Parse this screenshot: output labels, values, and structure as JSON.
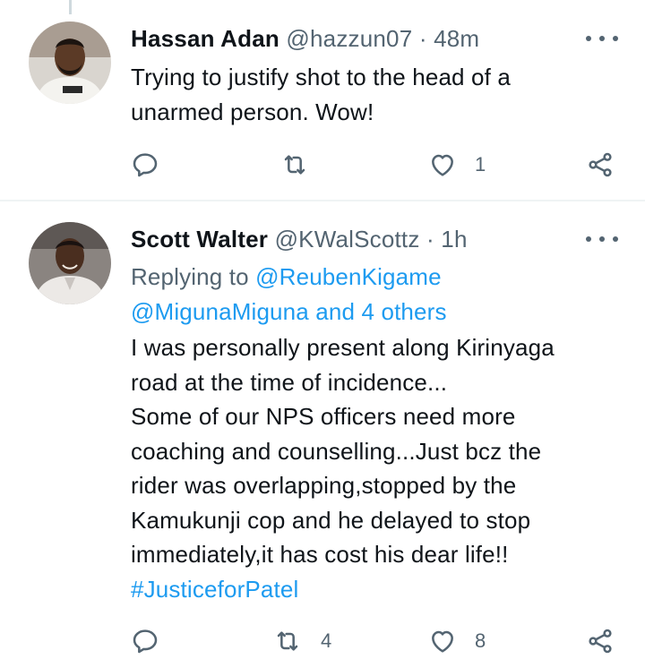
{
  "tweets": [
    {
      "name": "Hassan Adan",
      "handle": "@hazzun07",
      "sep": "·",
      "time": "48m",
      "lines": [
        "Trying to justify shot to the head of a",
        "unarmed person. Wow!"
      ],
      "actions": {
        "reply": "",
        "retweet": "",
        "like": "1"
      }
    },
    {
      "name": "Scott Walter",
      "handle": "@KWalScottz",
      "sep": "·",
      "time": "1h",
      "replying_prefix": "Replying to ",
      "replying_user": "@ReubenKigame",
      "replying_line2": "@MigunaMiguna and 4 others",
      "lines": [
        "I was personally present along Kirinyaga",
        "road at the time of incidence...",
        "Some of our NPS officers need more",
        "coaching and counselling...Just bcz the",
        "rider was overlapping,stopped by the",
        "Kamukunji cop and he delayed to stop",
        "immediately,it has cost his dear life!!"
      ],
      "hashtag": "#JusticeforPatel",
      "actions": {
        "reply": "",
        "retweet": "4",
        "like": "8"
      }
    }
  ],
  "icons": {
    "reply": "reply-icon",
    "retweet": "retweet-icon",
    "like": "heart-icon",
    "share": "share-icon",
    "more": "more-icon"
  },
  "colors": {
    "text": "#0f1419",
    "muted": "#536471",
    "link": "#1d9bf0",
    "divider": "#eff3f4"
  }
}
